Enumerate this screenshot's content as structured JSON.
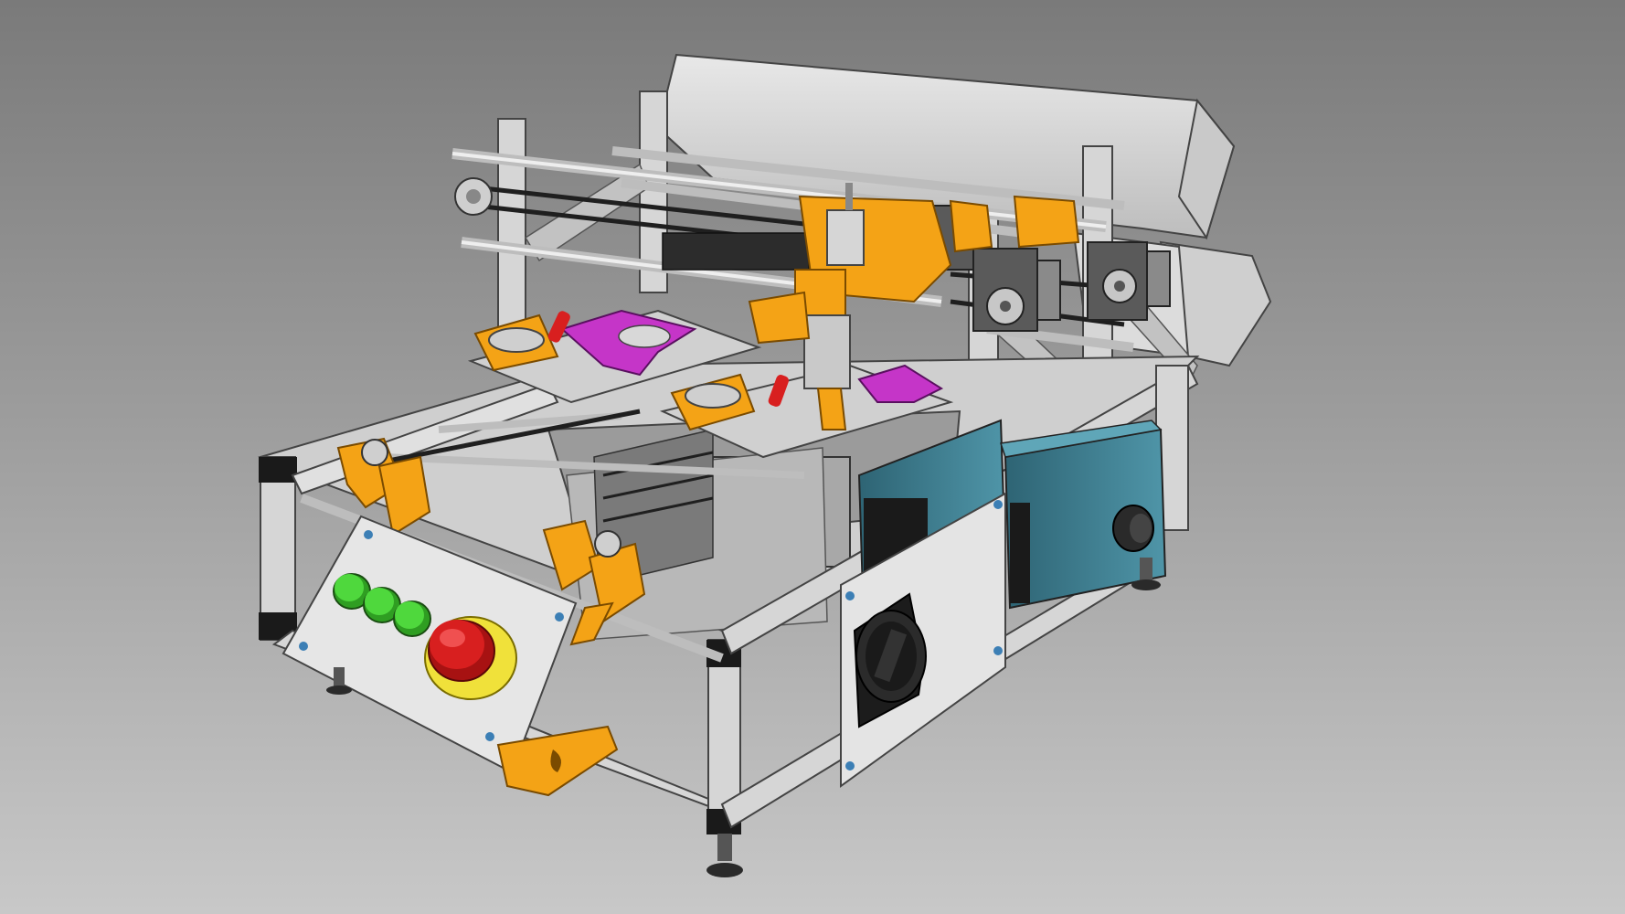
{
  "view": {
    "background_top": "#7a7a7a",
    "background_bottom": "#c8c8c8"
  },
  "colors": {
    "aluminium": "#d6d6d6",
    "aluminium_dark": "#a9a9a9",
    "printed_parts": "#f4a316",
    "nozzle_holders": "#c535c8",
    "stepper_body": "#5a5a5a",
    "belt": "#1f1f1f",
    "enclosure_box": "#3f7f92",
    "hood": "#d9d9d9",
    "start_buttons": "#3ec82e",
    "emergency_stop": "#d81f1f",
    "emergency_ring": "#f0e13a",
    "cover_panel": "#e6e6e6"
  },
  "components": {
    "green_buttons": 3,
    "emergency_stop": 1,
    "main_switch": 1,
    "stepper_motors": 3,
    "feeder_lanes": 3
  }
}
